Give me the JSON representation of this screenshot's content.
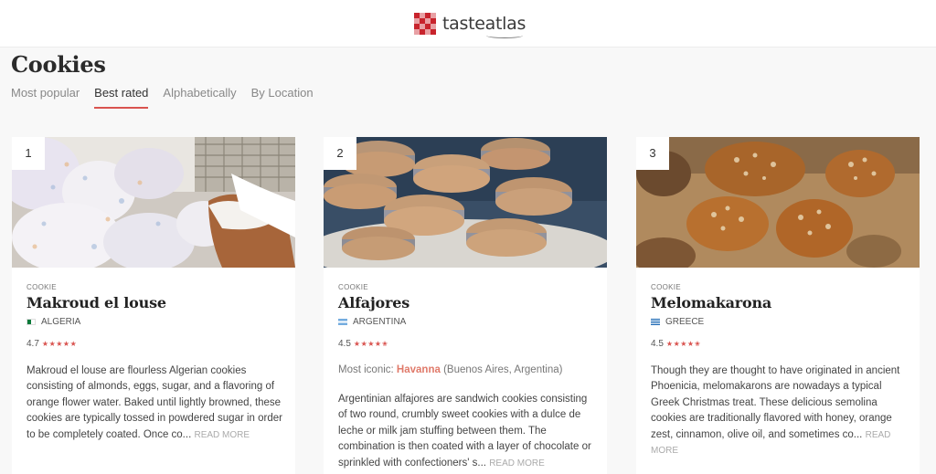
{
  "logo": {
    "text": "tasteatlas"
  },
  "page": {
    "title": "Cookies"
  },
  "tabs": [
    {
      "label": "Most popular"
    },
    {
      "label": "Best rated"
    },
    {
      "label": "Alphabetically"
    },
    {
      "label": "By Location"
    }
  ],
  "active_tab": "Best rated",
  "cards": [
    {
      "rank": "1",
      "category": "COOKIE",
      "name": "Makroud el louse",
      "country": "ALGERIA",
      "rating": "4.7",
      "stars": "★★★★★",
      "description": "Makroud el louse are flourless Algerian cookies consisting of almonds, eggs, sugar, and a flavoring of orange flower water. Baked until lightly browned, these cookies are typically tossed in powdered sugar in order to be completely coated. Once co...",
      "read_more": "READ MORE"
    },
    {
      "rank": "2",
      "category": "COOKIE",
      "name": "Alfajores",
      "country": "ARGENTINA",
      "rating": "4.5",
      "stars": "★★★★✬",
      "iconic_label": "Most iconic:",
      "iconic_place": "Havanna",
      "iconic_location": "(Buenos Aires, Argentina)",
      "description": "Argentinian alfajores are sandwich cookies consisting of two round, crumbly sweet cookies with a dulce de leche or milk jam stuffing between them. The combination is then coated with a layer of chocolate or sprinkled with confectioners' s...",
      "read_more": "READ MORE"
    },
    {
      "rank": "3",
      "category": "COOKIE",
      "name": "Melomakarona",
      "country": "GREECE",
      "rating": "4.5",
      "stars": "★★★★✬",
      "description": "Though they are thought to have originated in ancient Phoenicia, melomakarons are nowadays a typical Greek Christmas treat. These delicious semolina cookies are traditionally flavored with honey, orange zest, cinnamon, olive oil, and sometimes co...",
      "read_more": "READ MORE"
    }
  ],
  "colors": {
    "accent": "#d9534f",
    "logo_red": "#c8232c"
  }
}
